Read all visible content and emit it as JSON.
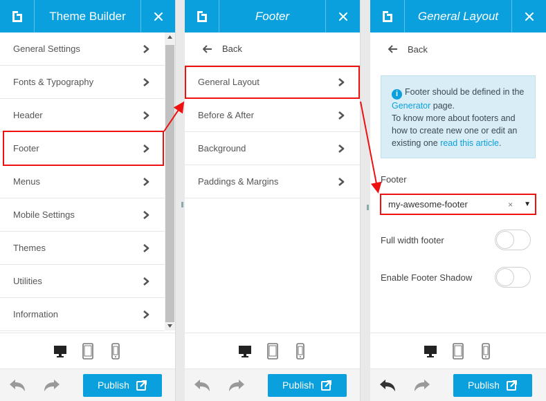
{
  "colors": {
    "brand": "#0aa0de",
    "highlight": "#ee1111",
    "info_bg": "#d9edf7"
  },
  "panel1": {
    "title": "Theme Builder",
    "items": [
      {
        "label": "General Settings"
      },
      {
        "label": "Fonts & Typography"
      },
      {
        "label": "Header"
      },
      {
        "label": "Footer"
      },
      {
        "label": "Menus"
      },
      {
        "label": "Mobile Settings"
      },
      {
        "label": "Themes"
      },
      {
        "label": "Utilities"
      },
      {
        "label": "Information"
      }
    ],
    "publish": "Publish"
  },
  "panel2": {
    "title": "Footer",
    "back": "Back",
    "items": [
      {
        "label": "General Layout"
      },
      {
        "label": "Before & After"
      },
      {
        "label": "Background"
      },
      {
        "label": "Paddings & Margins"
      }
    ],
    "publish": "Publish"
  },
  "panel3": {
    "title": "General Layout",
    "back": "Back",
    "info": {
      "t1": "Footer should be defined in the ",
      "link1": "Generator",
      "t2": " page.",
      "t3": "To know more about footers and how to create new one or edit an existing one ",
      "link2": "read this article",
      "t4": "."
    },
    "footer_label": "Footer",
    "footer_value": "my-awesome-footer",
    "full_width_label": "Full width footer",
    "full_width_on": false,
    "shadow_label": "Enable Footer Shadow",
    "shadow_on": false,
    "publish": "Publish"
  }
}
